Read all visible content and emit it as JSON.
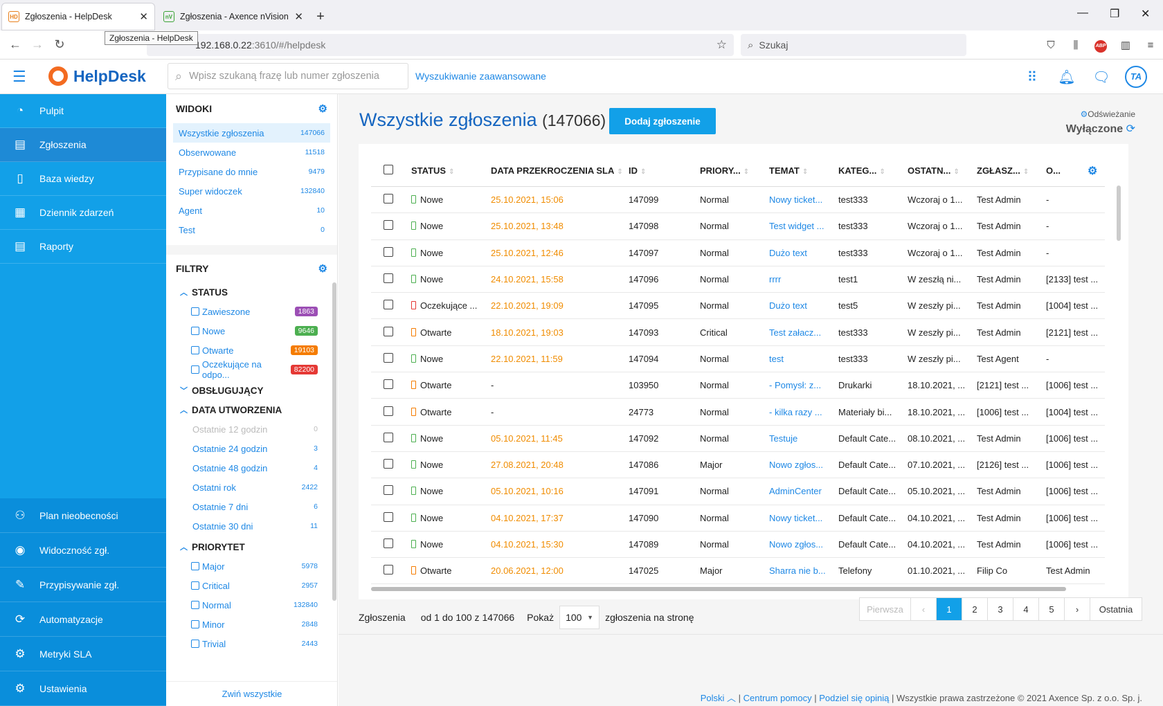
{
  "browser": {
    "tabs": [
      {
        "title": "Zgłoszenia - HelpDesk",
        "icon": "HD"
      },
      {
        "title": "Zgłoszenia - Axence nVision He",
        "icon": "nV"
      }
    ],
    "tooltip": "Zgłoszenia - HelpDesk",
    "url_host": "192.168.0.22",
    "url_rest": ":3610/#/helpdesk",
    "search_placeholder": "Szukaj",
    "abp": "ABP"
  },
  "header": {
    "logo": "HelpDesk",
    "search_placeholder": "Wpisz szukaną frazę lub numer zgłoszenia",
    "advanced": "Wyszukiwanie zaawansowane",
    "avatar": "TA"
  },
  "sidebar": {
    "top": [
      "Pulpit",
      "Zgłoszenia",
      "Baza wiedzy",
      "Dziennik zdarzeń",
      "Raporty"
    ],
    "bottom": [
      "Plan nieobecności",
      "Widoczność zgł.",
      "Przypisywanie zgł.",
      "Automatyzacje",
      "Metryki SLA",
      "Ustawienia"
    ]
  },
  "views": {
    "title": "WIDOKI",
    "items": [
      {
        "label": "Wszystkie zgłoszenia",
        "count": "147066"
      },
      {
        "label": "Obserwowane",
        "count": "11518"
      },
      {
        "label": "Przypisane do mnie",
        "count": "9479"
      },
      {
        "label": "Super widoczek",
        "count": "132840"
      },
      {
        "label": "Agent",
        "count": "10"
      },
      {
        "label": "Test",
        "count": "0"
      }
    ]
  },
  "filters": {
    "title": "FILTRY",
    "status_title": "STATUS",
    "status": [
      {
        "label": "Zawieszone",
        "count": "1863",
        "color": "#9c4fb5"
      },
      {
        "label": "Nowe",
        "count": "9646",
        "color": "#4caf50"
      },
      {
        "label": "Otwarte",
        "count": "19103",
        "color": "#f57c00"
      },
      {
        "label": "Oczekujące na odpo...",
        "count": "82200",
        "color": "#e53935"
      }
    ],
    "handler_title": "OBSŁUGUJĄCY",
    "date_title": "DATA UTWORZENIA",
    "dates": [
      {
        "label": "Ostatnie 12 godzin",
        "count": "0"
      },
      {
        "label": "Ostatnie 24 godzin",
        "count": "3"
      },
      {
        "label": "Ostatnie 48 godzin",
        "count": "4"
      },
      {
        "label": "Ostatni rok",
        "count": "2422"
      },
      {
        "label": "Ostatnie 7 dni",
        "count": "6"
      },
      {
        "label": "Ostatnie 30 dni",
        "count": "11"
      }
    ],
    "priority_title": "PRIORYTET",
    "priority": [
      {
        "label": "Major",
        "count": "5978"
      },
      {
        "label": "Critical",
        "count": "2957"
      },
      {
        "label": "Normal",
        "count": "132840"
      },
      {
        "label": "Minor",
        "count": "2848"
      },
      {
        "label": "Trivial",
        "count": "2443"
      }
    ],
    "collapse": "Zwiń wszystkie"
  },
  "main": {
    "title": "Wszystkie zgłoszenia",
    "count": "(147066)",
    "add_button": "Dodaj zgłoszenie",
    "refresh_label": "Odświeżanie",
    "refresh_value": "Wyłączone",
    "columns": [
      "STATUS",
      "DATA PRZEKROCZENIA SLA",
      "ID",
      "PRIORY...",
      "TEMAT",
      "KATEG...",
      "OSTATN...",
      "ZGŁASZ...",
      "O..."
    ],
    "rows": [
      {
        "status": "Nowe",
        "sc": "#4caf50",
        "sla": "25.10.2021, 15:06",
        "id": "147099",
        "prio": "Normal",
        "topic": "Nowy ticket...",
        "cat": "test333",
        "last": "Wczoraj o 1...",
        "rep": "Test Admin",
        "o": "-"
      },
      {
        "status": "Nowe",
        "sc": "#4caf50",
        "sla": "25.10.2021, 13:48",
        "id": "147098",
        "prio": "Normal",
        "topic": "Test widget ...",
        "cat": "test333",
        "last": "Wczoraj o 1...",
        "rep": "Test Admin",
        "o": "-"
      },
      {
        "status": "Nowe",
        "sc": "#4caf50",
        "sla": "25.10.2021, 12:46",
        "id": "147097",
        "prio": "Normal",
        "topic": "Dużo text",
        "cat": "test333",
        "last": "Wczoraj o 1...",
        "rep": "Test Admin",
        "o": "-"
      },
      {
        "status": "Nowe",
        "sc": "#4caf50",
        "sla": "24.10.2021, 15:58",
        "id": "147096",
        "prio": "Normal",
        "topic": "rrrr",
        "cat": "test1",
        "last": "W zeszłą ni...",
        "rep": "Test Admin",
        "o": "[2133] test ..."
      },
      {
        "status": "Oczekujące ...",
        "sc": "#e53935",
        "sla": "22.10.2021, 19:09",
        "id": "147095",
        "prio": "Normal",
        "topic": "Dużo text",
        "cat": "test5",
        "last": "W zeszły pi...",
        "rep": "Test Admin",
        "o": "[1004] test ..."
      },
      {
        "status": "Otwarte",
        "sc": "#f57c00",
        "sla": "18.10.2021, 19:03",
        "id": "147093",
        "prio": "Critical",
        "topic": "Test załacz...",
        "cat": "test333",
        "last": "W zeszły pi...",
        "rep": "Test Admin",
        "o": "[2121] test ..."
      },
      {
        "status": "Nowe",
        "sc": "#4caf50",
        "sla": "22.10.2021, 11:59",
        "id": "147094",
        "prio": "Normal",
        "topic": "test",
        "cat": "test333",
        "last": "W zeszły pi...",
        "rep": "Test Agent",
        "o": "-"
      },
      {
        "status": "Otwarte",
        "sc": "#f57c00",
        "sla": "-",
        "id": "103950",
        "prio": "Normal",
        "topic": "- Pomysł: z...",
        "cat": "Drukarki",
        "last": "18.10.2021, ...",
        "rep": "[2121] test ...",
        "o": "[1006] test ..."
      },
      {
        "status": "Otwarte",
        "sc": "#f57c00",
        "sla": "-",
        "id": "24773",
        "prio": "Normal",
        "topic": "- kilka razy ...",
        "cat": "Materiały bi...",
        "last": "18.10.2021, ...",
        "rep": "[1006] test ...",
        "o": "[1004] test ..."
      },
      {
        "status": "Nowe",
        "sc": "#4caf50",
        "sla": "05.10.2021, 11:45",
        "id": "147092",
        "prio": "Normal",
        "topic": "Testuje",
        "cat": "Default Cate...",
        "last": "08.10.2021, ...",
        "rep": "Test Admin",
        "o": "[1006] test ..."
      },
      {
        "status": "Nowe",
        "sc": "#4caf50",
        "sla": "27.08.2021, 20:48",
        "id": "147086",
        "prio": "Major",
        "topic": "Nowo zgłos...",
        "cat": "Default Cate...",
        "last": "07.10.2021, ...",
        "rep": "[2126] test ...",
        "o": "[1006] test ..."
      },
      {
        "status": "Nowe",
        "sc": "#4caf50",
        "sla": "05.10.2021, 10:16",
        "id": "147091",
        "prio": "Normal",
        "topic": "AdminCenter",
        "cat": "Default Cate...",
        "last": "05.10.2021, ...",
        "rep": "Test Admin",
        "o": "[1006] test ..."
      },
      {
        "status": "Nowe",
        "sc": "#4caf50",
        "sla": "04.10.2021, 17:37",
        "id": "147090",
        "prio": "Normal",
        "topic": "Nowy ticket...",
        "cat": "Default Cate...",
        "last": "04.10.2021, ...",
        "rep": "Test Admin",
        "o": "[1006] test ..."
      },
      {
        "status": "Nowe",
        "sc": "#4caf50",
        "sla": "04.10.2021, 15:30",
        "id": "147089",
        "prio": "Normal",
        "topic": "Nowo zgłos...",
        "cat": "Default Cate...",
        "last": "04.10.2021, ...",
        "rep": "Test Admin",
        "o": "[1006] test ..."
      },
      {
        "status": "Otwarte",
        "sc": "#f57c00",
        "sla": "20.06.2021, 12:00",
        "id": "147025",
        "prio": "Major",
        "topic": "Sharra nie b...",
        "cat": "Telefony",
        "last": "01.10.2021, ...",
        "rep": "Filip Co",
        "o": "Test Admin"
      }
    ],
    "footer": {
      "label": "Zgłoszenia",
      "range": "od 1 do 100 z 147066",
      "show": "Pokaż",
      "per_page": "100",
      "suffix": "zgłoszenia na stronę",
      "first": "Pierwsza",
      "prev": "‹",
      "pages": [
        "1",
        "2",
        "3",
        "4",
        "5"
      ],
      "next": "›",
      "last": "Ostatnia"
    },
    "copyright": {
      "lang": "Polski",
      "help": "Centrum pomocy",
      "feedback": "Podziel się opinią",
      "rights": "Wszystkie prawa zastrzeżone © 2021 Axence Sp. z o.o. Sp. j."
    }
  }
}
